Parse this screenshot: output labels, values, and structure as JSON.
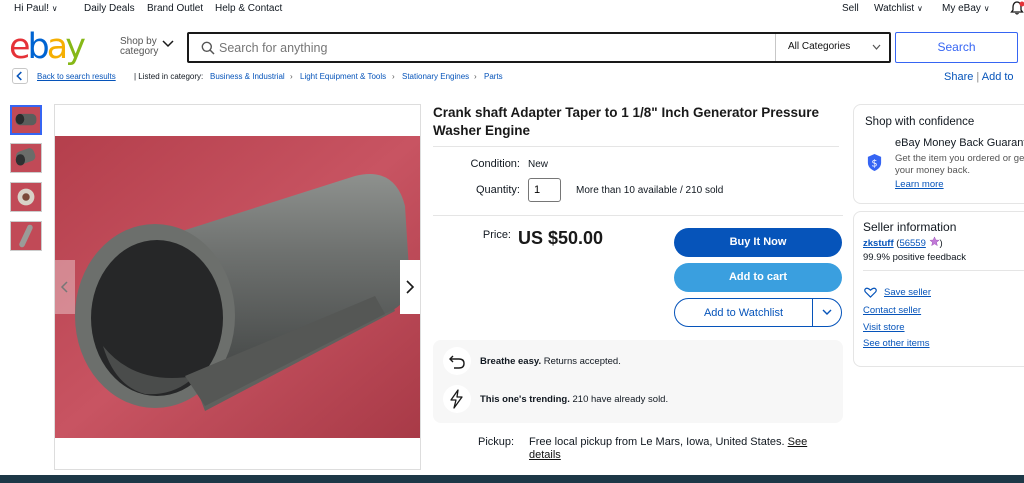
{
  "topbar": {
    "greeting": "Hi Paul!",
    "daily_deals": "Daily Deals",
    "brand_outlet": "Brand Outlet",
    "help_contact": "Help & Contact",
    "sell": "Sell",
    "watchlist": "Watchlist",
    "my_ebay": "My eBay"
  },
  "header": {
    "logo_letters": [
      "e",
      "b",
      "a",
      "y"
    ],
    "logo_colors": [
      "#e53238",
      "#0064d2",
      "#f5af02",
      "#86b817"
    ],
    "shop_by_line1": "Shop by",
    "shop_by_line2": "category",
    "search_placeholder": "Search for anything",
    "category_selected": "All Categories",
    "search_button": "Search"
  },
  "breadcrumb": {
    "back": "Back to search results",
    "listed_in": "| Listed in category:",
    "items": [
      "Business & Industrial",
      "Light Equipment & Tools",
      "Stationary Engines",
      "Parts"
    ],
    "share": "Share",
    "add_to": "Add to"
  },
  "item": {
    "title": "Crank shaft Adapter Taper to 1 1/8\" Inch Generator Pressure Washer Engine",
    "condition_label": "Condition:",
    "condition_value": "New",
    "quantity_label": "Quantity:",
    "quantity_value": "1",
    "availability": "More than 10 available / 210 sold",
    "price_label": "Price:",
    "price": "US $50.00",
    "buy_now": "Buy It Now",
    "add_to_cart": "Add to cart",
    "add_to_watchlist": "Add to Watchlist",
    "info": [
      {
        "icon": "return-arrow-icon",
        "bold": "Breathe easy.",
        "text": " Returns accepted."
      },
      {
        "icon": "lightning-icon",
        "bold": "This one's trending.",
        "text": " 210 have already sold."
      }
    ],
    "pickup_label": "Pickup:",
    "pickup_text": "Free local pickup from Le Mars, Iowa, United States.",
    "pickup_link": "See details"
  },
  "confidence": {
    "title": "Shop with confidence",
    "guarantee_title": "eBay Money Back Guarantee",
    "guarantee_desc_1": "Get the item you ordered or get",
    "guarantee_desc_2": "your money back.",
    "learn_more": "Learn more"
  },
  "seller": {
    "title": "Seller information",
    "name": "zkstuff",
    "rating": "56559",
    "feedback": "99.9% positive feedback",
    "save_seller": "Save seller",
    "contact": "Contact seller",
    "visit_store": "Visit store",
    "other_items": "See other items"
  },
  "colors": {
    "primary_blue": "#0654ba",
    "cart_blue": "#3a9fdf",
    "photo_background": "#c14a57"
  }
}
